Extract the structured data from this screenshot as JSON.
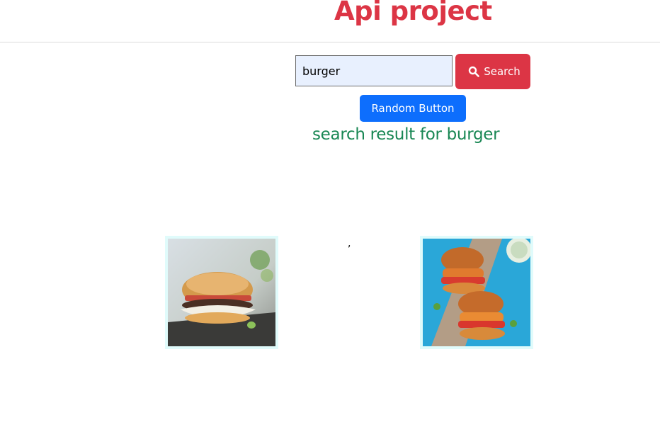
{
  "header": {
    "title": "Api project"
  },
  "search": {
    "value": "burger",
    "button_label": "Search",
    "icon": "search-icon"
  },
  "random": {
    "button_label": "Random Button"
  },
  "result": {
    "text": "search result for burger"
  },
  "separator": ",",
  "colors": {
    "title": "#dc3545",
    "search_button": "#dc3545",
    "random_button": "#0d6efd",
    "result_text": "#198754",
    "card_bg": "#e0fbfb"
  }
}
